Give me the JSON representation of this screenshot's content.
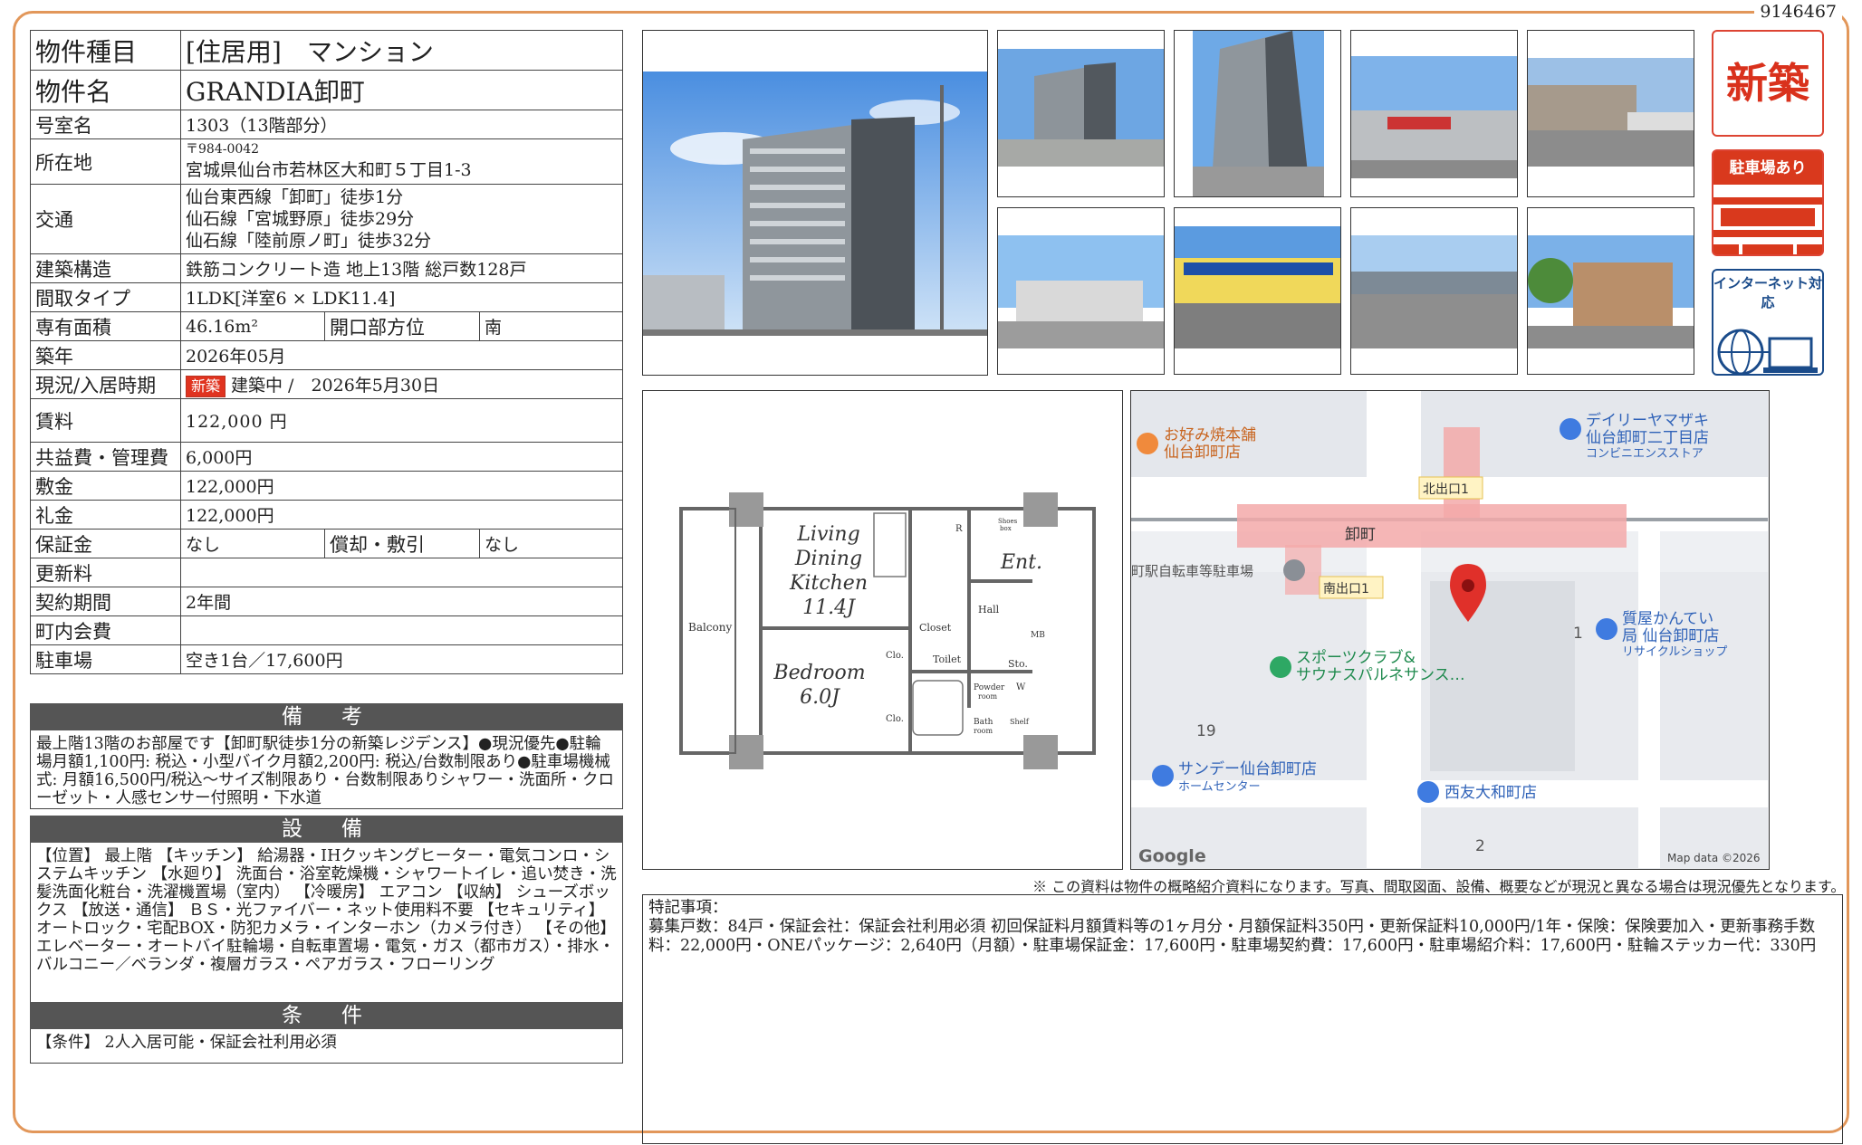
{
  "doc_number": "9146467",
  "spec": {
    "type_label": "物件種目",
    "type_value": "[住居用]　マンション",
    "name_label": "物件名",
    "name_value": "GRANDIA卸町",
    "room_label": "号室名",
    "room_value": "1303（13階部分）",
    "address_label": "所在地",
    "address_zip": "〒984-0042",
    "address_value": "宮城県仙台市若林区大和町５丁目1-3",
    "access_label": "交通",
    "access_lines": [
      "仙台東西線「卸町」徒歩1分",
      "仙石線「宮城野原」徒歩29分",
      "仙石線「陸前原ノ町」徒歩32分"
    ],
    "structure_label": "建築構造",
    "structure_value": "鉄筋コンクリート造 地上13階 総戸数128戸",
    "layout_label": "間取タイプ",
    "layout_value": "1LDK[洋室6 × LDK11.4]",
    "area_label": "専有面積",
    "area_value": "46.16m²",
    "direction_label": "開口部方位",
    "direction_value": "南",
    "built_label": "築年",
    "built_value": "2026年05月",
    "status_label": "現況/入居時期",
    "status_badge": "新築",
    "status_value": "建築中 /　2026年5月30日",
    "rent_label": "賃料",
    "rent_value": "122,000 円",
    "fee_label": "共益費・管理費",
    "fee_value": "6,000円",
    "deposit_label": "敷金",
    "deposit_value": "122,000円",
    "key_label": "礼金",
    "key_value": "122,000円",
    "guarantee_label": "保証金",
    "guarantee_value": "なし",
    "amort_label": "償却・敷引",
    "amort_value": "なし",
    "renewal_label": "更新料",
    "renewal_value": "",
    "term_label": "契約期間",
    "term_value": "2年間",
    "town_label": "町内会費",
    "town_value": "",
    "parking_label": "駐車場",
    "parking_value": "空き1台／17,600円"
  },
  "bikou": {
    "title": "備　考",
    "text": "最上階13階のお部屋です【卸町駅徒歩1分の新築レジデンス】●現況優先●駐輪場月額1,100円: 税込・小型バイク月額2,200円: 税込/台数制限あり●駐車場機械式: 月額16,500円/税込～サイズ制限あり・台数制限ありシャワー・洗面所・クローゼット・人感センサー付照明・下水道"
  },
  "setsubi": {
    "title": "設　備",
    "text": "【位置】 最上階 【キッチン】 給湯器・IHクッキングヒーター・電気コンロ・システムキッチン 【水廻り】 洗面台・浴室乾燥機・シャワートイレ・追い焚き・洗髪洗面化粧台・洗濯機置場（室内） 【冷暖房】 エアコン 【収納】 シューズボックス 【放送・通信】 ＢＳ・光ファイバー・ネット使用料不要 【セキュリティ】 オートロック・宅配BOX・防犯カメラ・インターホン（カメラ付き） 【その他】 エレベーター・オートバイ駐輪場・自転車置場・電気・ガス（都市ガス）・排水・バルコニー／ベランダ・複層ガラス・ペアガラス・フローリング"
  },
  "joken": {
    "title": "条　件",
    "text": "【条件】 2人入居可能・保証会社利用必須"
  },
  "badges": {
    "new": "新築",
    "parking": "駐車場あり",
    "internet": "インターネット対応"
  },
  "floorplan": {
    "ldk": [
      "Living",
      "Dining",
      "Kitchen",
      "11.4J"
    ],
    "bedroom": [
      "Bedroom",
      "6.0J"
    ],
    "balcony": "Balcony",
    "ent": "Ent.",
    "hall": "Hall",
    "closet": "Closet",
    "toilet": "Toilet",
    "sto": "Sto.",
    "powder": "Powder",
    "powder2": "room",
    "bath": "Bath",
    "bath2": "room",
    "clo": "Clo.",
    "shelf": "Shelf",
    "mb": "MB",
    "w": "W",
    "r": "R",
    "shoes": "Shoes",
    "shoes2": "box"
  },
  "map": {
    "okonomiyaki": "お好み焼本舗",
    "okonomiyaki2": "仙台卸町店",
    "daily": "デイリーヤマザキ",
    "daily2": "仙台卸町二丁目店",
    "daily3": "コンビニエンスストア",
    "north_exit": "北出口1",
    "station": "卸町",
    "bike_park": "町駅自転車等駐車場",
    "south_exit": "南出口1",
    "sports": "スポーツクラブ&",
    "sports2": "サウナスパルネサンス…",
    "pawn": "質屋かんてい",
    "pawn2": "局 仙台卸町店",
    "pawn3": "リサイクルショップ",
    "sunday": "サンデー仙台卸町店",
    "sunday2": "ホームセンター",
    "seiyu": "西友大和町店",
    "num1": "1",
    "num19": "19",
    "num2": "2",
    "google": "Google",
    "mapdata": "Map data ©2026"
  },
  "note": "※ この資料は物件の概略紹介資料になります。写真、間取図面、設備、概要などが現況と異なる場合は現況優先となります。",
  "remarks": {
    "title": "特記事項：",
    "text": "募集戸数：84戸・保証会社：保証会社利用必須 初回保証料月額賃料等の1ヶ月分・月額保証料350円・更新保証料10,000円/1年・保険：保険要加入・更新事務手数料：22,000円・ONEパッケージ：2,640円（月額）・駐車場保証金：17,600円・駐車場契約費：17,600円・駐車場紹介料：17,600円・駐輪ステッカー代：330円"
  },
  "colors": {
    "frame": "#e2975a",
    "section_bar": "#555555",
    "new_red": "#d9311c",
    "net_blue": "#1a4b8a"
  }
}
